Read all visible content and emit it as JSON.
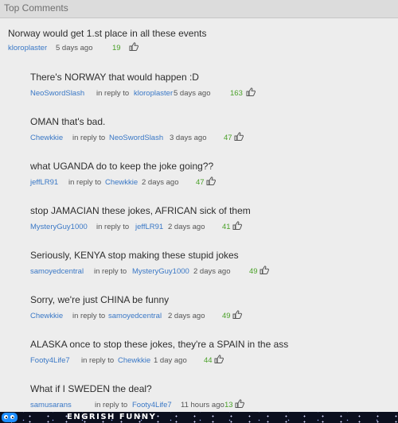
{
  "header": {
    "title": "Top Comments"
  },
  "comments": [
    {
      "text": "Norway would get 1.st place in all these events",
      "user": "kloroplaster",
      "in_reply_to_label": "",
      "reply_user": "",
      "time": "5 days ago",
      "votes": "19"
    },
    {
      "text": "There's NORWAY that would happen :D",
      "user": "NeoSwordSlash",
      "in_reply_to_label": "in reply to",
      "reply_user": "kloroplaster",
      "time": "5 days ago",
      "votes": "163"
    },
    {
      "text": "OMAN that's bad.",
      "user": "Chewkkie",
      "in_reply_to_label": "in reply to",
      "reply_user": "NeoSwordSlash",
      "time": "3 days ago",
      "votes": "47"
    },
    {
      "text": "what UGANDA do to keep the joke going??",
      "user": "jeffLR91",
      "in_reply_to_label": "in reply to",
      "reply_user": "Chewkkie",
      "time": "2 days ago",
      "votes": "47"
    },
    {
      "text": "stop JAMACIAN these jokes, AFRICAN sick of them",
      "user": "MysteryGuy1000",
      "in_reply_to_label": "in reply to",
      "reply_user": "jeffLR91",
      "time": "2 days ago",
      "votes": "41"
    },
    {
      "text": "Seriously, KENYA stop making these stupid jokes",
      "user": "samoyedcentral",
      "in_reply_to_label": "in reply to",
      "reply_user": "MysteryGuy1000",
      "time": "2 days ago",
      "votes": "49"
    },
    {
      "text": "Sorry, we're just CHINA be funny",
      "user": "Chewkkie",
      "in_reply_to_label": "in reply to",
      "reply_user": "samoyedcentral",
      "time": "2 days ago",
      "votes": "49"
    },
    {
      "text": "ALASKA once to stop these jokes, they're a SPAIN in the ass",
      "user": "Footy4Life7",
      "in_reply_to_label": "in reply to",
      "reply_user": "Chewkkie",
      "time": "1 day ago",
      "votes": "44"
    },
    {
      "text": "What if I SWEDEN the deal?",
      "user": "samusarans",
      "in_reply_to_label": "in reply to",
      "reply_user": "Footy4Life7",
      "time": "11 hours ago",
      "votes": "13"
    }
  ],
  "footer": {
    "brand": "ENGRISH FUNNY"
  },
  "colors": {
    "user_link": "#3a78c6",
    "votes": "#4aa128",
    "background": "#ededed"
  },
  "icons": {
    "thumb": "thumbs-up-icon"
  }
}
